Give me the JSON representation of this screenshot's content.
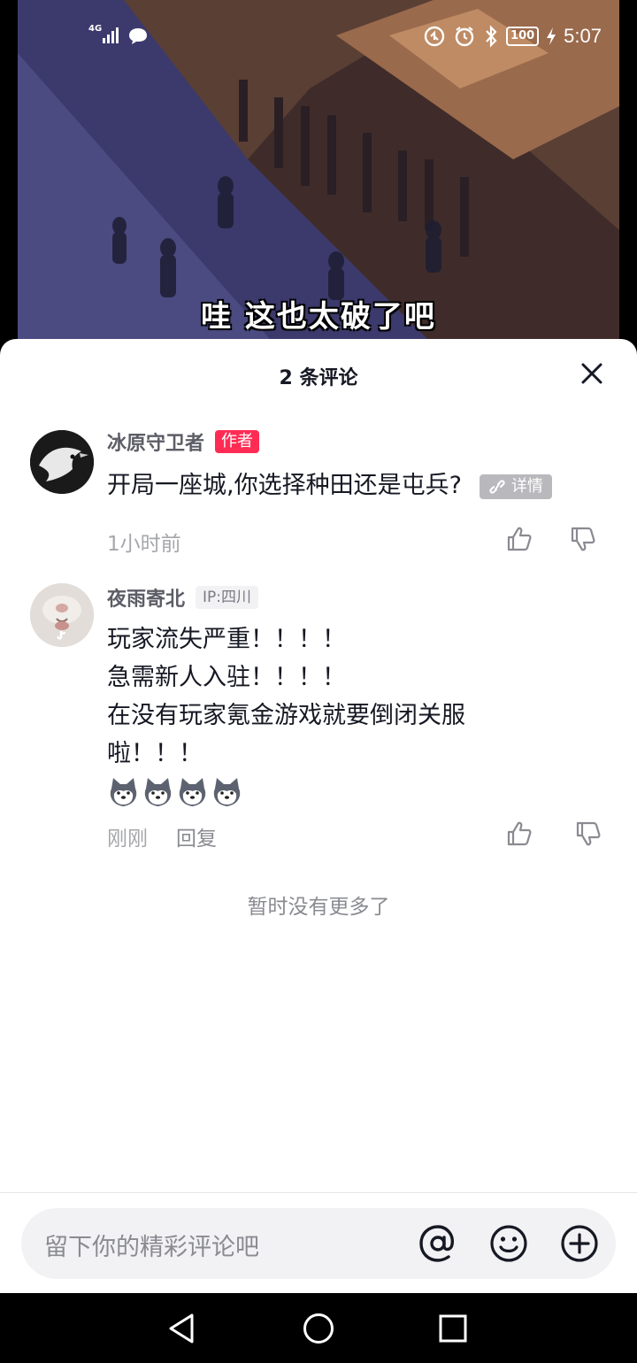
{
  "video": {
    "subtitle": "哇  这也太破了吧"
  },
  "status_bar": {
    "network": "4G",
    "battery": "100",
    "time": "5:07"
  },
  "sheet": {
    "title": "2 条评论",
    "comments": [
      {
        "username": "冰原守卫者",
        "author_tag": "作者",
        "text": "开局一座城,你选择种田还是屯兵?",
        "detail_chip": "详情",
        "time": "1小时前"
      },
      {
        "username": "夜雨寄北",
        "ip_tag": "IP:四川",
        "text": "玩家流失严重！！！！\n急需新人入驻！！！！\n在没有玩家氪金游戏就要倒闭关服\n啦！！！",
        "emoji": [
          "husky-emoji",
          "husky-emoji",
          "husky-emoji",
          "husky-emoji"
        ],
        "time": "刚刚",
        "reply_label": "回复"
      }
    ],
    "no_more": "暂时没有更多了"
  },
  "input": {
    "placeholder": "留下你的精彩评论吧",
    "icons": [
      "at-icon",
      "emoji-icon",
      "plus-icon"
    ]
  },
  "nav": {
    "icons": [
      "back-icon",
      "home-icon",
      "recents-icon"
    ]
  },
  "colors": {
    "accent": "#fe2c55",
    "text_primary": "#161823",
    "text_secondary": "#a6a7ab"
  }
}
